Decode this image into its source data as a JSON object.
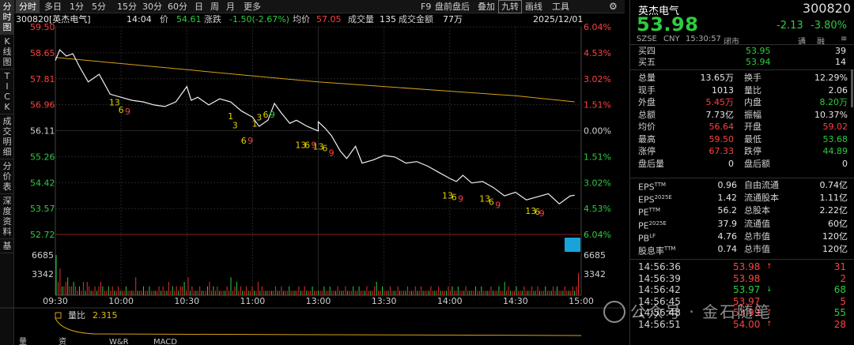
{
  "left_tabs": [
    {
      "label": "分\n时\n图",
      "active": true
    },
    {
      "label": "K\n线\n图",
      "active": false
    },
    {
      "label": "T\nI\nC\nK",
      "active": false
    },
    {
      "label": "成\n交\n明\n细",
      "active": false
    },
    {
      "label": "分\n价\n表",
      "active": false
    },
    {
      "label": "深\n度\n资\n料",
      "active": false
    },
    {
      "label": "基",
      "active": false
    }
  ],
  "toolbar": {
    "periods": [
      "分时",
      "多日",
      "1分",
      "5分",
      "15分",
      "30分",
      "60分",
      "日",
      "周",
      "月",
      "更多"
    ],
    "active_period": "分时",
    "right_items": [
      "F9",
      "盘前盘后",
      "叠加",
      "九转",
      "画线",
      "工具"
    ],
    "boxed_item": "九转",
    "settings_icon": "settings-icon"
  },
  "info": {
    "code_name": "300820[英杰电气]",
    "time": "14:04",
    "price_label": "价",
    "price": "54.61",
    "change_label": "涨跌",
    "change": "-1.50(-2.67%)",
    "avg_label": "均价",
    "avg": "57.05",
    "vol_label": "成交量",
    "vol": "135",
    "amount_label": "成交金额",
    "amount": "77万",
    "date": "2025/12/01"
  },
  "chart_data": {
    "type": "line",
    "price_axis_left": [
      "59.50",
      "58.65",
      "57.81",
      "56.96",
      "56.11",
      "55.26",
      "54.42",
      "53.57",
      "52.72"
    ],
    "price_axis_right": [
      "6.04%",
      "4.53%",
      "3.02%",
      "1.51%",
      "0.00%",
      "1.51%",
      "3.02%",
      "4.53%",
      "6.04%"
    ],
    "ylim": [
      52.72,
      59.5
    ],
    "vol_axis_left": [
      "6685",
      "3342"
    ],
    "vol_axis_right": [
      "6685",
      "3342"
    ],
    "x_ticks": [
      "09:30",
      "10:00",
      "10:30",
      "11:00",
      "13:00",
      "13:30",
      "14:00",
      "14:30",
      "15:00"
    ],
    "price_series": {
      "name": "",
      "x": [
        "09:30",
        "09:32",
        "09:35",
        "09:38",
        "09:41",
        "09:45",
        "09:50",
        "09:55",
        "10:00",
        "10:05",
        "10:10",
        "10:15",
        "10:20",
        "10:25",
        "10:30",
        "10:32",
        "10:35",
        "10:40",
        "10:45",
        "10:50",
        "10:55",
        "11:00",
        "11:03",
        "11:07",
        "11:10",
        "11:13",
        "11:17",
        "11:20",
        "11:25",
        "11:30",
        "13:00",
        "13:03",
        "13:06",
        "13:10",
        "13:13",
        "13:17",
        "13:20",
        "13:25",
        "13:30",
        "13:35",
        "13:40",
        "13:45",
        "13:50",
        "13:55",
        "14:00",
        "14:03",
        "14:06",
        "14:10",
        "14:15",
        "14:20",
        "14:25",
        "14:30",
        "14:35",
        "14:40",
        "14:45",
        "14:50",
        "14:55",
        "14:57"
      ],
      "y": [
        58.4,
        58.75,
        58.55,
        58.62,
        58.2,
        57.7,
        57.95,
        57.3,
        57.2,
        57.1,
        57.05,
        56.95,
        56.9,
        57.05,
        57.55,
        57.1,
        57.2,
        56.95,
        57.15,
        57.05,
        56.75,
        56.55,
        56.25,
        56.45,
        57.0,
        56.7,
        56.35,
        56.45,
        56.25,
        56.1,
        56.4,
        56.2,
        55.95,
        55.45,
        55.2,
        55.6,
        55.05,
        55.15,
        55.3,
        55.25,
        55.05,
        55.1,
        54.95,
        54.75,
        54.55,
        54.45,
        54.65,
        54.4,
        54.45,
        54.25,
        53.98,
        54.1,
        53.85,
        53.95,
        54.05,
        53.72,
        53.98,
        54.0
      ]
    },
    "avg_series": {
      "name": "",
      "x": [
        "09:30",
        "10:00",
        "10:30",
        "11:00",
        "13:00",
        "13:30",
        "14:00",
        "14:30",
        "14:57"
      ],
      "y": [
        58.5,
        58.3,
        58.1,
        57.9,
        57.7,
        57.55,
        57.4,
        57.25,
        57.05
      ]
    },
    "td_labels": [
      {
        "text": "13",
        "color": "#e0d000",
        "x": "09:57",
        "y": 57.3
      },
      {
        "text": "6",
        "color": "#e0d000",
        "x": "10:00",
        "y": 57.05
      },
      {
        "text": "9",
        "color": "#ff4040",
        "x": "10:03",
        "y": 57.0
      },
      {
        "text": "1",
        "color": "#e0d000",
        "x": "10:50",
        "y": 56.85
      },
      {
        "text": "3",
        "color": "#e0d000",
        "x": "10:52",
        "y": 56.55
      },
      {
        "text": "6",
        "color": "#e0d000",
        "x": "10:56",
        "y": 56.05
      },
      {
        "text": "9",
        "color": "#ff4040",
        "x": "10:59",
        "y": 56.05
      },
      {
        "text": "1",
        "color": "#e0d000",
        "x": "11:01",
        "y": 56.6
      },
      {
        "text": "3",
        "color": "#e0d000",
        "x": "11:03",
        "y": 56.8
      },
      {
        "text": "6",
        "color": "#e0d000",
        "x": "11:06",
        "y": 56.9
      },
      {
        "text": "9",
        "color": "#2ecc40",
        "x": "11:09",
        "y": 56.9
      },
      {
        "text": "13",
        "color": "#e0d000",
        "x": "11:22",
        "y": 55.9
      },
      {
        "text": "6",
        "color": "#e0d000",
        "x": "11:25",
        "y": 55.9
      },
      {
        "text": "9",
        "color": "#ff4040",
        "x": "11:28",
        "y": 55.9
      },
      {
        "text": "13",
        "color": "#e0d000",
        "x": "13:00",
        "y": 55.85
      },
      {
        "text": "6",
        "color": "#e0d000",
        "x": "13:03",
        "y": 55.8
      },
      {
        "text": "9",
        "color": "#ff4040",
        "x": "13:06",
        "y": 55.65
      },
      {
        "text": "13",
        "color": "#e0d000",
        "x": "13:59",
        "y": 54.25
      },
      {
        "text": "6",
        "color": "#e0d000",
        "x": "14:02",
        "y": 54.2
      },
      {
        "text": "9",
        "color": "#ff4040",
        "x": "14:05",
        "y": 54.15
      },
      {
        "text": "13",
        "color": "#e0d000",
        "x": "14:16",
        "y": 54.15
      },
      {
        "text": "6",
        "color": "#e0d000",
        "x": "14:19",
        "y": 54.05
      },
      {
        "text": "9",
        "color": "#ff4040",
        "x": "14:22",
        "y": 53.95
      },
      {
        "text": "13",
        "color": "#e0d000",
        "x": "14:37",
        "y": 53.75
      },
      {
        "text": "6",
        "color": "#e0d000",
        "x": "14:40",
        "y": 53.72
      },
      {
        "text": "9",
        "color": "#ff4040",
        "x": "14:42",
        "y": 53.68
      }
    ],
    "volume_series": {
      "name": "",
      "values": [
        9,
        3,
        6,
        2,
        2,
        3,
        4,
        2,
        2,
        3,
        2,
        1,
        2,
        1,
        3,
        1,
        3,
        2,
        1,
        1,
        2,
        1,
        2,
        3,
        2,
        1,
        1,
        2,
        1,
        2,
        1,
        1,
        2,
        1,
        1,
        1,
        2,
        1,
        1,
        1,
        1,
        4,
        1,
        1,
        1,
        2,
        1,
        1,
        2,
        1,
        1,
        1,
        1,
        2,
        1,
        2,
        1,
        1,
        3,
        1,
        2,
        1,
        2,
        1,
        2,
        2,
        3,
        1,
        4,
        1,
        2,
        1,
        1,
        1,
        2,
        1,
        1,
        1,
        2,
        3,
        1,
        2,
        1,
        2,
        1,
        1,
        1,
        1,
        2,
        1,
        4,
        1,
        2,
        3,
        1,
        2,
        1,
        1,
        2,
        1,
        1,
        2,
        1,
        1,
        3,
        1,
        2,
        1,
        1,
        1,
        1,
        1,
        1,
        2,
        1,
        1,
        2,
        1,
        1,
        1,
        2,
        1,
        1,
        1,
        1,
        2,
        1,
        1,
        2,
        1,
        1,
        1,
        2,
        1,
        1,
        1,
        1,
        1,
        2,
        1,
        1,
        2,
        1,
        1,
        1,
        2,
        1,
        1,
        1,
        2,
        1,
        1,
        1,
        2,
        1,
        1,
        2,
        1,
        1,
        1,
        2,
        1,
        1,
        1,
        2,
        3,
        1,
        1,
        2,
        1,
        1,
        1,
        2,
        1,
        1,
        1,
        2,
        1,
        1,
        1,
        1,
        2,
        1,
        1,
        1,
        2,
        1,
        1,
        2,
        1,
        1,
        1,
        1,
        2,
        1,
        1,
        1,
        2,
        1,
        1,
        1,
        1,
        2,
        1,
        2,
        1,
        1,
        2,
        1,
        1,
        1,
        2,
        1,
        1,
        1,
        1,
        2,
        1,
        1,
        2,
        1,
        1,
        1,
        1,
        2,
        1,
        1,
        1,
        2,
        1,
        1,
        3,
        1,
        2,
        1,
        1,
        1,
        2,
        1,
        1,
        1,
        2,
        1,
        1,
        1,
        2,
        1,
        1,
        2,
        1,
        1,
        1,
        2,
        1,
        1,
        1,
        2,
        1,
        2,
        1,
        1,
        1,
        2,
        1,
        1,
        1,
        2,
        1,
        2,
        5
      ],
      "max": 6685
    },
    "volume_ratio_label": "量比",
    "volume_ratio": "2.315",
    "grid": true
  },
  "bottom_tabs": [
    "量比",
    "资金流向",
    "W&R比",
    "MACD"
  ],
  "right_panel": {
    "name": "英杰电气",
    "code": "300820",
    "price": "53.98",
    "change": "-2.13",
    "change_pct": "-3.80%",
    "market": "SZSE",
    "currency": "CNY",
    "time": "15:30:57",
    "status": "闭市",
    "tags": [
      "通",
      "融",
      "≡"
    ],
    "order_book": [
      {
        "label": "买四",
        "price": "53.95",
        "vol": "39"
      },
      {
        "label": "买五",
        "price": "53.94",
        "vol": "14"
      }
    ],
    "stats": [
      {
        "l1": "总量",
        "v1": "13.65万",
        "c1": "w",
        "l2": "换手",
        "v2": "12.29%",
        "c2": "w"
      },
      {
        "l1": "现手",
        "v1": "1013",
        "c1": "w",
        "l2": "量比",
        "v2": "2.06",
        "c2": "w"
      },
      {
        "l1": "外盘",
        "v1": "5.45万",
        "c1": "r",
        "l2": "内盘",
        "v2": "8.20万",
        "c2": "g"
      },
      {
        "l1": "总额",
        "v1": "7.73亿",
        "c1": "w",
        "l2": "振幅",
        "v2": "10.37%",
        "c2": "w"
      },
      {
        "l1": "均价",
        "v1": "56.64",
        "c1": "r",
        "l2": "开盘",
        "v2": "59.02",
        "c2": "r"
      },
      {
        "l1": "最高",
        "v1": "59.50",
        "c1": "r",
        "l2": "最低",
        "v2": "53.68",
        "c2": "g"
      },
      {
        "l1": "涨停",
        "v1": "67.33",
        "c1": "r",
        "l2": "跌停",
        "v2": "44.89",
        "c2": "g"
      },
      {
        "l1": "盘后量",
        "v1": "0",
        "c1": "w",
        "l2": "盘后额",
        "v2": "0",
        "c2": "w"
      }
    ],
    "fundamentals": [
      {
        "l1": "EPS",
        "s1": "TTM",
        "v1": "0.96",
        "l2": "自由流通",
        "v2": "0.74亿"
      },
      {
        "l1": "EPS",
        "s1": "2025E",
        "v1": "1.42",
        "l2": "流通股本",
        "v2": "1.11亿"
      },
      {
        "l1": "PE",
        "s1": "TTM",
        "v1": "56.2",
        "l2": "总股本",
        "v2": "2.22亿"
      },
      {
        "l1": "PE",
        "s1": "2025E",
        "v1": "37.9",
        "l2": "流通值",
        "v2": "60亿"
      },
      {
        "l1": "PB",
        "s1": "LF",
        "v1": "4.76",
        "l2": "总市值",
        "v2": "120亿"
      },
      {
        "l1": "股息率",
        "s1": "TTM",
        "v1": "0.74",
        "l2": "总市值",
        "v2": "120亿"
      }
    ],
    "ticks": [
      {
        "time": "14:56:36",
        "price": "53.98",
        "dir": "up",
        "vol": "31",
        "vc": "r"
      },
      {
        "time": "14:56:39",
        "price": "53.98",
        "dir": "",
        "vol": "2",
        "vc": "r"
      },
      {
        "time": "14:56:42",
        "price": "53.97",
        "dir": "down",
        "vol": "68",
        "vc": "g"
      },
      {
        "time": "14:56:45",
        "price": "53.97",
        "dir": "",
        "vol": "5",
        "vc": "r"
      },
      {
        "time": "14:56:48",
        "price": "53.99",
        "dir": "up",
        "vol": "55",
        "vc": "g"
      },
      {
        "time": "14:56:51",
        "price": "54.00",
        "dir": "up",
        "vol": "28",
        "vc": "r"
      }
    ]
  },
  "watermark": "公众号 · 金石随笔"
}
